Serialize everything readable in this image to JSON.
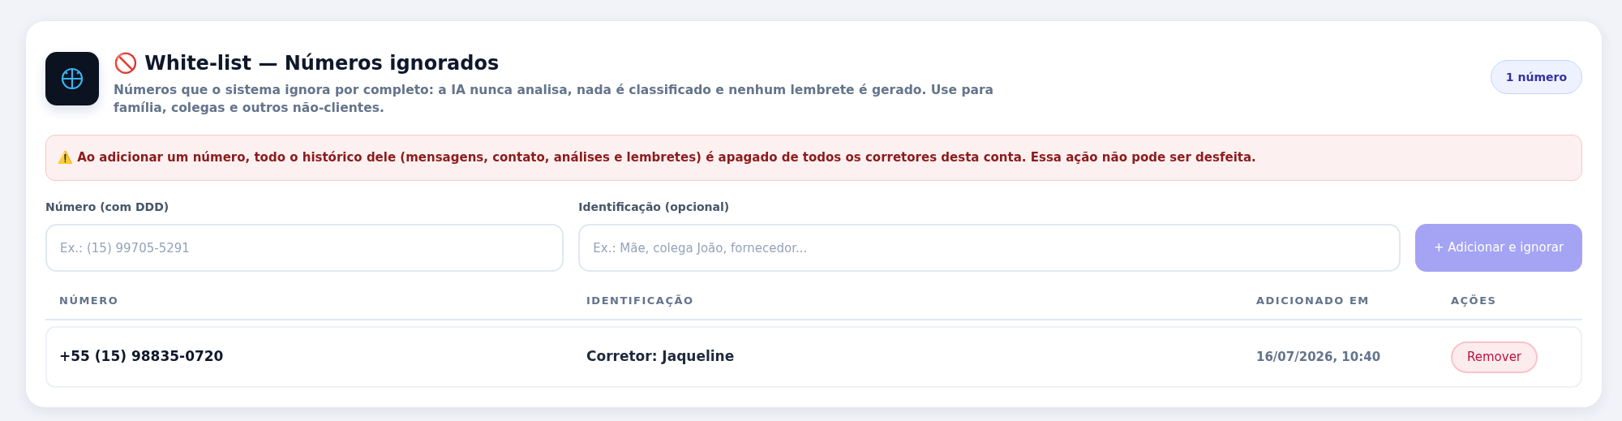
{
  "header": {
    "title": "🚫 White-list — Números ignorados",
    "description": "Números que o sistema ignora por completo: a IA nunca analisa, nada é classificado e nenhum lembrete é gerado. Use para família, colegas e outros não-clientes.",
    "count_badge": "1 número"
  },
  "warning": "⚠️ Ao adicionar um número, todo o histórico dele (mensagens, contato, análises e lembretes) é **apagado de todos os corretores** desta conta. Essa ação não pode ser desfeita.",
  "form": {
    "number_field": {
      "label": "Número (com DDD)",
      "placeholder": "Ex.: (15) 99705-5291"
    },
    "identification_field": {
      "label": "Identificação (opcional)",
      "placeholder": "Ex.: Mãe, colega João, fornecedor..."
    },
    "submit_button": {
      "label": "+ Adicionar e ignorar",
      "disabled": true
    }
  },
  "table": {
    "columns": [
      "NÚMERO",
      "IDENTIFICAÇÃO",
      "ADICIONADO EM",
      "AÇÕES"
    ],
    "rows": [
      {
        "number": "+55 (15) 98835-0720",
        "identification": "Corretor: Jaqueline",
        "added_at": "16/07/2026, 10:40",
        "action": "Remover"
      }
    ]
  }
}
